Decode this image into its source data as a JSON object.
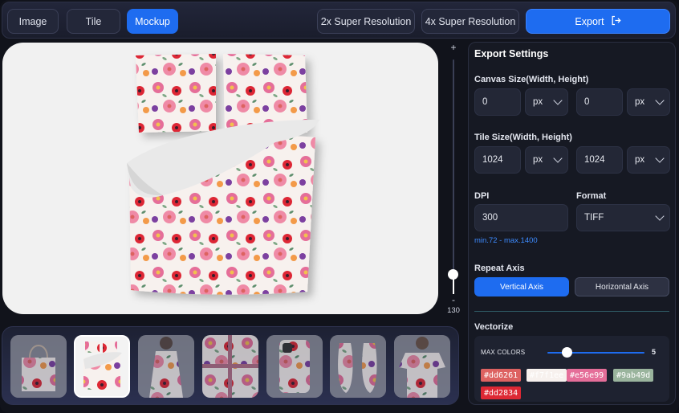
{
  "topbar": {
    "tabs": [
      {
        "label": "Image",
        "active": false
      },
      {
        "label": "Tile",
        "active": false
      },
      {
        "label": "Mockup",
        "active": true
      }
    ],
    "sr2_label": "2x Super Resolution",
    "sr4_label": "4x Super Resolution",
    "export_label": "Export",
    "export_icon": "logout-arrow-icon"
  },
  "zoom": {
    "plus": "+",
    "minus": "-",
    "value": "130"
  },
  "thumbnails": [
    {
      "name": "tote-bag",
      "active": false
    },
    {
      "name": "duvet-cover",
      "active": true
    },
    {
      "name": "dress",
      "active": false
    },
    {
      "name": "wrapping-paper",
      "active": false
    },
    {
      "name": "phone-case",
      "active": false
    },
    {
      "name": "shoes",
      "active": false
    },
    {
      "name": "t-shirt",
      "active": false
    }
  ],
  "export_settings": {
    "title": "Export Settings",
    "canvas_size": {
      "label": "Canvas Size(Width, Height)",
      "width": "0",
      "width_unit": "px",
      "height": "0",
      "height_unit": "px"
    },
    "tile_size": {
      "label": "Tile Size(Width, Height)",
      "width": "1024",
      "width_unit": "px",
      "height": "1024",
      "height_unit": "px"
    },
    "dpi": {
      "label": "DPI",
      "value": "300",
      "hint": "min.72 - max.1400"
    },
    "format": {
      "label": "Format",
      "value": "TIFF"
    },
    "repeat_axis": {
      "label": "Repeat Axis",
      "vertical": "Vertical Axis",
      "horizontal": "Horizontal Axis",
      "selected": "vertical"
    },
    "vectorize": {
      "label": "Vectorize",
      "max_colors_label": "MAX COLORS",
      "max_colors_value": "5",
      "max_colors_fraction": 0.2,
      "colors": [
        {
          "hex": "#dd6261",
          "bg": "#dd6261",
          "fg": "#ffffff"
        },
        {
          "hex": "#f7f1ee",
          "bg": "#f7f1ee",
          "fg": "#ffffff"
        },
        {
          "hex": "#e56e99",
          "bg": "#e56e99",
          "fg": "#ffffff"
        },
        {
          "hex": "#9ab49d",
          "bg": "#9ab49d",
          "fg": "#ffffff"
        },
        {
          "hex": "#dd2834",
          "bg": "#dd2834",
          "fg": "#ffffff"
        }
      ]
    }
  },
  "colors": {
    "accent": "#1e6cf0",
    "hint": "#3d8bff",
    "panel_bg": "#161923"
  }
}
